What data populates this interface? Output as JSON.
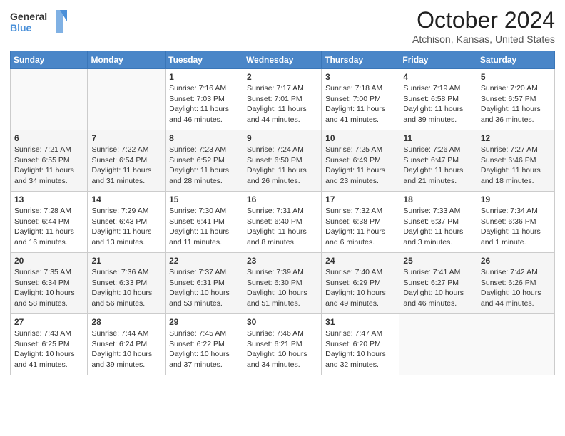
{
  "header": {
    "logo_line1": "General",
    "logo_line2": "Blue",
    "month": "October 2024",
    "location": "Atchison, Kansas, United States"
  },
  "weekdays": [
    "Sunday",
    "Monday",
    "Tuesday",
    "Wednesday",
    "Thursday",
    "Friday",
    "Saturday"
  ],
  "weeks": [
    [
      {
        "day": "",
        "info": ""
      },
      {
        "day": "",
        "info": ""
      },
      {
        "day": "1",
        "info": "Sunrise: 7:16 AM\nSunset: 7:03 PM\nDaylight: 11 hours and 46 minutes."
      },
      {
        "day": "2",
        "info": "Sunrise: 7:17 AM\nSunset: 7:01 PM\nDaylight: 11 hours and 44 minutes."
      },
      {
        "day": "3",
        "info": "Sunrise: 7:18 AM\nSunset: 7:00 PM\nDaylight: 11 hours and 41 minutes."
      },
      {
        "day": "4",
        "info": "Sunrise: 7:19 AM\nSunset: 6:58 PM\nDaylight: 11 hours and 39 minutes."
      },
      {
        "day": "5",
        "info": "Sunrise: 7:20 AM\nSunset: 6:57 PM\nDaylight: 11 hours and 36 minutes."
      }
    ],
    [
      {
        "day": "6",
        "info": "Sunrise: 7:21 AM\nSunset: 6:55 PM\nDaylight: 11 hours and 34 minutes."
      },
      {
        "day": "7",
        "info": "Sunrise: 7:22 AM\nSunset: 6:54 PM\nDaylight: 11 hours and 31 minutes."
      },
      {
        "day": "8",
        "info": "Sunrise: 7:23 AM\nSunset: 6:52 PM\nDaylight: 11 hours and 28 minutes."
      },
      {
        "day": "9",
        "info": "Sunrise: 7:24 AM\nSunset: 6:50 PM\nDaylight: 11 hours and 26 minutes."
      },
      {
        "day": "10",
        "info": "Sunrise: 7:25 AM\nSunset: 6:49 PM\nDaylight: 11 hours and 23 minutes."
      },
      {
        "day": "11",
        "info": "Sunrise: 7:26 AM\nSunset: 6:47 PM\nDaylight: 11 hours and 21 minutes."
      },
      {
        "day": "12",
        "info": "Sunrise: 7:27 AM\nSunset: 6:46 PM\nDaylight: 11 hours and 18 minutes."
      }
    ],
    [
      {
        "day": "13",
        "info": "Sunrise: 7:28 AM\nSunset: 6:44 PM\nDaylight: 11 hours and 16 minutes."
      },
      {
        "day": "14",
        "info": "Sunrise: 7:29 AM\nSunset: 6:43 PM\nDaylight: 11 hours and 13 minutes."
      },
      {
        "day": "15",
        "info": "Sunrise: 7:30 AM\nSunset: 6:41 PM\nDaylight: 11 hours and 11 minutes."
      },
      {
        "day": "16",
        "info": "Sunrise: 7:31 AM\nSunset: 6:40 PM\nDaylight: 11 hours and 8 minutes."
      },
      {
        "day": "17",
        "info": "Sunrise: 7:32 AM\nSunset: 6:38 PM\nDaylight: 11 hours and 6 minutes."
      },
      {
        "day": "18",
        "info": "Sunrise: 7:33 AM\nSunset: 6:37 PM\nDaylight: 11 hours and 3 minutes."
      },
      {
        "day": "19",
        "info": "Sunrise: 7:34 AM\nSunset: 6:36 PM\nDaylight: 11 hours and 1 minute."
      }
    ],
    [
      {
        "day": "20",
        "info": "Sunrise: 7:35 AM\nSunset: 6:34 PM\nDaylight: 10 hours and 58 minutes."
      },
      {
        "day": "21",
        "info": "Sunrise: 7:36 AM\nSunset: 6:33 PM\nDaylight: 10 hours and 56 minutes."
      },
      {
        "day": "22",
        "info": "Sunrise: 7:37 AM\nSunset: 6:31 PM\nDaylight: 10 hours and 53 minutes."
      },
      {
        "day": "23",
        "info": "Sunrise: 7:39 AM\nSunset: 6:30 PM\nDaylight: 10 hours and 51 minutes."
      },
      {
        "day": "24",
        "info": "Sunrise: 7:40 AM\nSunset: 6:29 PM\nDaylight: 10 hours and 49 minutes."
      },
      {
        "day": "25",
        "info": "Sunrise: 7:41 AM\nSunset: 6:27 PM\nDaylight: 10 hours and 46 minutes."
      },
      {
        "day": "26",
        "info": "Sunrise: 7:42 AM\nSunset: 6:26 PM\nDaylight: 10 hours and 44 minutes."
      }
    ],
    [
      {
        "day": "27",
        "info": "Sunrise: 7:43 AM\nSunset: 6:25 PM\nDaylight: 10 hours and 41 minutes."
      },
      {
        "day": "28",
        "info": "Sunrise: 7:44 AM\nSunset: 6:24 PM\nDaylight: 10 hours and 39 minutes."
      },
      {
        "day": "29",
        "info": "Sunrise: 7:45 AM\nSunset: 6:22 PM\nDaylight: 10 hours and 37 minutes."
      },
      {
        "day": "30",
        "info": "Sunrise: 7:46 AM\nSunset: 6:21 PM\nDaylight: 10 hours and 34 minutes."
      },
      {
        "day": "31",
        "info": "Sunrise: 7:47 AM\nSunset: 6:20 PM\nDaylight: 10 hours and 32 minutes."
      },
      {
        "day": "",
        "info": ""
      },
      {
        "day": "",
        "info": ""
      }
    ]
  ]
}
